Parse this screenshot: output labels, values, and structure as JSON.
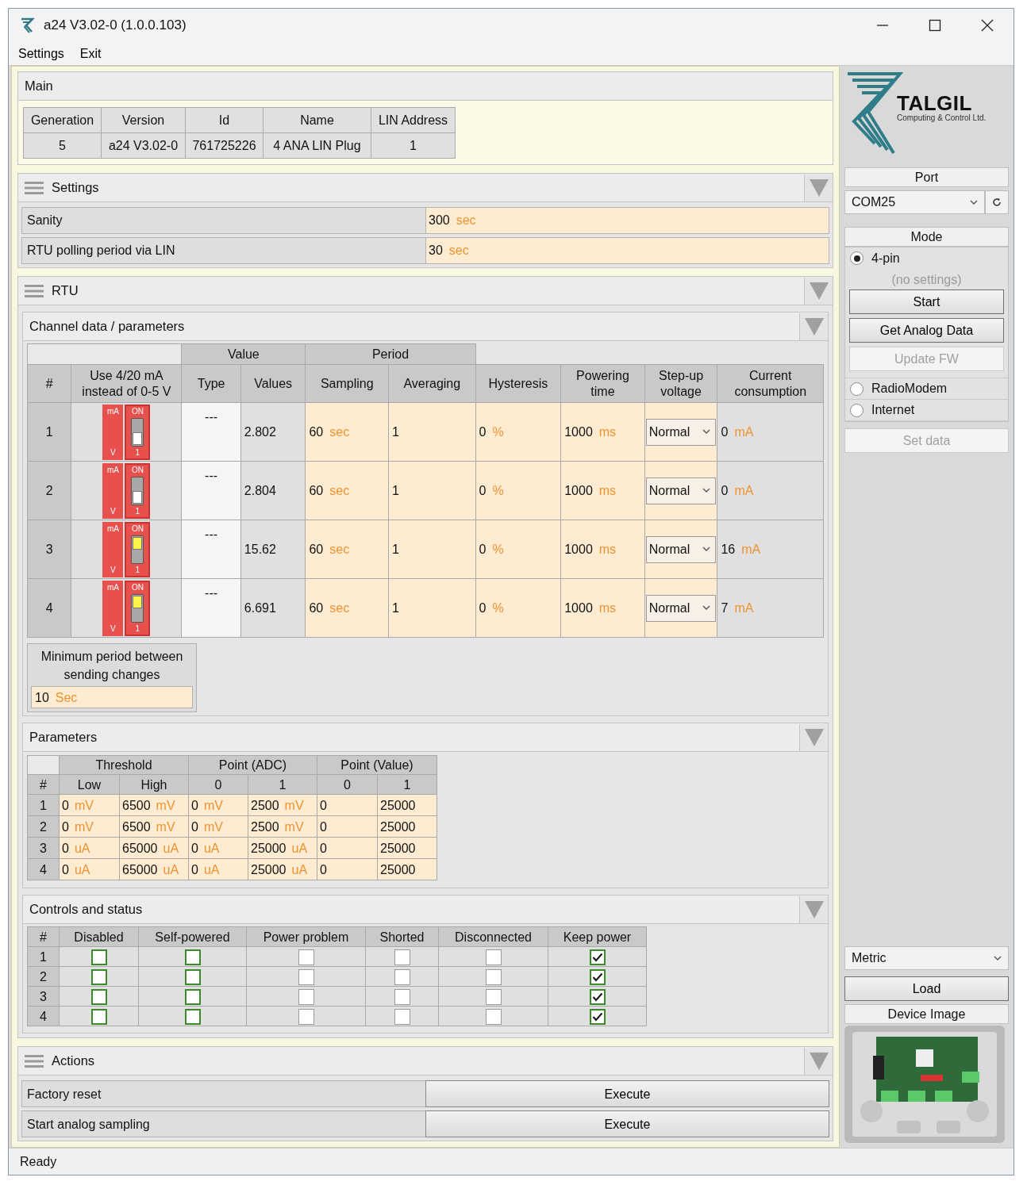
{
  "window": {
    "title": "a24 V3.02-0 (1.0.0.103)"
  },
  "menu": [
    "Settings",
    "Exit"
  ],
  "main": {
    "title": "Main",
    "columns": [
      "Generation",
      "Version",
      "Id",
      "Name",
      "LIN Address"
    ],
    "row": [
      "5",
      "a24 V3.02-0",
      "761725226",
      "4 ANA LIN Plug",
      "1"
    ]
  },
  "settings": {
    "title": "Settings",
    "rows": [
      {
        "label": "Sanity",
        "value": "300",
        "unit": "sec"
      },
      {
        "label": "RTU polling period via LIN",
        "value": "30",
        "unit": "sec"
      }
    ]
  },
  "rtu": {
    "title": "RTU",
    "channel_data": {
      "title": "Channel data / parameters",
      "group_headers": [
        "Value",
        "Period"
      ],
      "columns": [
        "#",
        "Use 4/20 mA instead of 0-5 V",
        "Type",
        "Values",
        "Sampling",
        "Averaging",
        "Hysteresis",
        "Powering time",
        "Step-up voltage",
        "Current consumption"
      ],
      "rows": [
        {
          "num": "1",
          "switch": {
            "top": "mA",
            "bottom": "V",
            "on_label": "ON",
            "number": "1",
            "on": false
          },
          "type": "---",
          "value": "2.802",
          "sampling": {
            "value": "60",
            "unit": "sec"
          },
          "averaging": "1",
          "hysteresis": {
            "value": "0",
            "unit": "%"
          },
          "powering_time": {
            "value": "1000",
            "unit": "ms"
          },
          "step_up": "Normal",
          "current": {
            "value": "0",
            "unit": "mA"
          }
        },
        {
          "num": "2",
          "switch": {
            "top": "mA",
            "bottom": "V",
            "on_label": "ON",
            "number": "1",
            "on": false
          },
          "type": "---",
          "value": "2.804",
          "sampling": {
            "value": "60",
            "unit": "sec"
          },
          "averaging": "1",
          "hysteresis": {
            "value": "0",
            "unit": "%"
          },
          "powering_time": {
            "value": "1000",
            "unit": "ms"
          },
          "step_up": "Normal",
          "current": {
            "value": "0",
            "unit": "mA"
          }
        },
        {
          "num": "3",
          "switch": {
            "top": "mA",
            "bottom": "V",
            "on_label": "ON",
            "number": "1",
            "on": true
          },
          "type": "---",
          "value": "15.62",
          "sampling": {
            "value": "60",
            "unit": "sec"
          },
          "averaging": "1",
          "hysteresis": {
            "value": "0",
            "unit": "%"
          },
          "powering_time": {
            "value": "1000",
            "unit": "ms"
          },
          "step_up": "Normal",
          "current": {
            "value": "16",
            "unit": "mA"
          }
        },
        {
          "num": "4",
          "switch": {
            "top": "mA",
            "bottom": "V",
            "on_label": "ON",
            "number": "1",
            "on": true
          },
          "type": "---",
          "value": "6.691",
          "sampling": {
            "value": "60",
            "unit": "sec"
          },
          "averaging": "1",
          "hysteresis": {
            "value": "0",
            "unit": "%"
          },
          "powering_time": {
            "value": "1000",
            "unit": "ms"
          },
          "step_up": "Normal",
          "current": {
            "value": "7",
            "unit": "mA"
          }
        }
      ],
      "min_period": {
        "label": "Minimum period between sending changes",
        "value": "10",
        "unit": "Sec"
      }
    },
    "parameters": {
      "title": "Parameters",
      "group_headers": [
        "Threshold",
        "Point (ADC)",
        "Point (Value)"
      ],
      "columns": [
        "#",
        "Low",
        "High",
        "0",
        "1",
        "0",
        "1"
      ],
      "rows": [
        {
          "cells": [
            {
              "value": "1"
            },
            {
              "value": "0",
              "unit": "mV"
            },
            {
              "value": "6500",
              "unit": "mV"
            },
            {
              "value": "0",
              "unit": "mV"
            },
            {
              "value": "2500",
              "unit": "mV"
            },
            {
              "value": "0"
            },
            {
              "value": "25000"
            }
          ]
        },
        {
          "cells": [
            {
              "value": "2"
            },
            {
              "value": "0",
              "unit": "mV"
            },
            {
              "value": "6500",
              "unit": "mV"
            },
            {
              "value": "0",
              "unit": "mV"
            },
            {
              "value": "2500",
              "unit": "mV"
            },
            {
              "value": "0"
            },
            {
              "value": "25000"
            }
          ]
        },
        {
          "cells": [
            {
              "value": "3"
            },
            {
              "value": "0",
              "unit": "uA"
            },
            {
              "value": "65000",
              "unit": "uA"
            },
            {
              "value": "0",
              "unit": "uA"
            },
            {
              "value": "25000",
              "unit": "uA"
            },
            {
              "value": "0"
            },
            {
              "value": "25000"
            }
          ]
        },
        {
          "cells": [
            {
              "value": "4"
            },
            {
              "value": "0",
              "unit": "uA"
            },
            {
              "value": "65000",
              "unit": "uA"
            },
            {
              "value": "0",
              "unit": "uA"
            },
            {
              "value": "25000",
              "unit": "uA"
            },
            {
              "value": "0"
            },
            {
              "value": "25000"
            }
          ]
        }
      ]
    },
    "controls": {
      "title": "Controls and status",
      "columns": [
        {
          "label": "#"
        },
        {
          "label": "Disabled",
          "kind": "control"
        },
        {
          "label": "Self-powered",
          "kind": "control"
        },
        {
          "label": "Power problem",
          "kind": "status"
        },
        {
          "label": "Shorted",
          "kind": "status"
        },
        {
          "label": "Disconnected",
          "kind": "status"
        },
        {
          "label": "Keep power",
          "kind": "control"
        }
      ],
      "rows": [
        {
          "num": "1",
          "checked": [
            false,
            false,
            false,
            false,
            false,
            true
          ]
        },
        {
          "num": "2",
          "checked": [
            false,
            false,
            false,
            false,
            false,
            true
          ]
        },
        {
          "num": "3",
          "checked": [
            false,
            false,
            false,
            false,
            false,
            true
          ]
        },
        {
          "num": "4",
          "checked": [
            false,
            false,
            false,
            false,
            false,
            true
          ]
        }
      ]
    }
  },
  "actions": {
    "title": "Actions",
    "rows": [
      {
        "label": "Factory reset",
        "button": "Execute"
      },
      {
        "label": "Start analog sampling",
        "button": "Execute"
      }
    ]
  },
  "sidebar": {
    "logo": {
      "name": "TALGIL",
      "tagline": "Computing & Control Ltd."
    },
    "port": {
      "title": "Port",
      "value": "COM25"
    },
    "mode": {
      "title": "Mode",
      "options": [
        {
          "label": "4-pin",
          "selected": true,
          "note": "(no settings)",
          "buttons": [
            {
              "label": "Start",
              "disabled": false
            },
            {
              "label": "Get Analog Data",
              "disabled": false
            },
            {
              "label": "Update FW",
              "disabled": true
            }
          ]
        },
        {
          "label": "RadioModem",
          "selected": false
        },
        {
          "label": "Internet",
          "selected": false
        }
      ]
    },
    "set_data": {
      "label": "Set data",
      "disabled": true
    },
    "units": "Metric",
    "load": "Load",
    "device_image_title": "Device Image"
  },
  "status_bar": "Ready"
}
